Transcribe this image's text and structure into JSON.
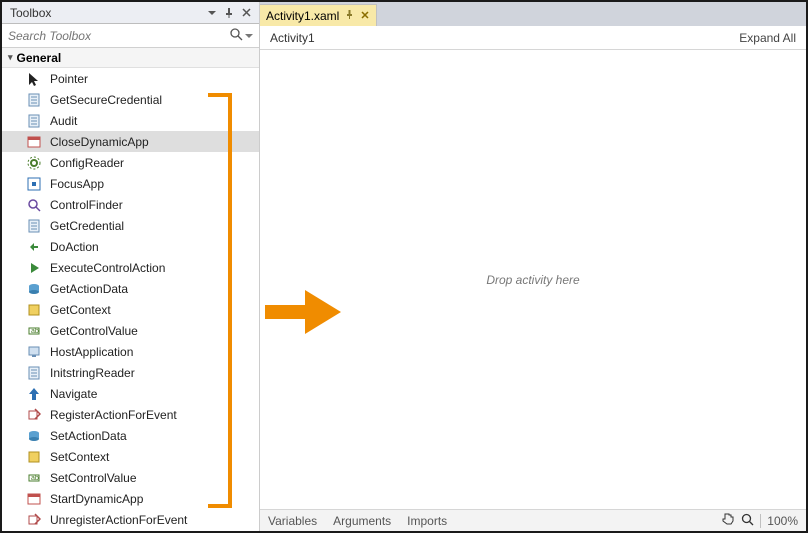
{
  "toolbox": {
    "title": "Toolbox",
    "search_placeholder": "Search Toolbox",
    "group_label": "General",
    "items": [
      {
        "name": "pointer",
        "label": "Pointer",
        "icon": "pointer",
        "selected": false
      },
      {
        "name": "getsecure",
        "label": "GetSecureCredential",
        "icon": "doc",
        "selected": false
      },
      {
        "name": "audit",
        "label": "Audit",
        "icon": "doc",
        "selected": false
      },
      {
        "name": "closedyn",
        "label": "CloseDynamicApp",
        "icon": "app",
        "selected": true
      },
      {
        "name": "configreader",
        "label": "ConfigReader",
        "icon": "gear",
        "selected": false
      },
      {
        "name": "focusapp",
        "label": "FocusApp",
        "icon": "focus",
        "selected": false
      },
      {
        "name": "ctrlfinder",
        "label": "ControlFinder",
        "icon": "find",
        "selected": false
      },
      {
        "name": "getcred",
        "label": "GetCredential",
        "icon": "doc",
        "selected": false
      },
      {
        "name": "doaction",
        "label": "DoAction",
        "icon": "action",
        "selected": false
      },
      {
        "name": "execctrl",
        "label": "ExecuteControlAction",
        "icon": "exec",
        "selected": false
      },
      {
        "name": "getactdata",
        "label": "GetActionData",
        "icon": "data",
        "selected": false
      },
      {
        "name": "getcontext",
        "label": "GetContext",
        "icon": "ctx",
        "selected": false
      },
      {
        "name": "getctrlval",
        "label": "GetControlValue",
        "icon": "val",
        "selected": false
      },
      {
        "name": "hostapp",
        "label": "HostApplication",
        "icon": "host",
        "selected": false
      },
      {
        "name": "initstr",
        "label": "InitstringReader",
        "icon": "doc",
        "selected": false
      },
      {
        "name": "navigate",
        "label": "Navigate",
        "icon": "nav",
        "selected": false
      },
      {
        "name": "regaction",
        "label": "RegisterActionForEvent",
        "icon": "reg",
        "selected": false
      },
      {
        "name": "setactdata",
        "label": "SetActionData",
        "icon": "data",
        "selected": false
      },
      {
        "name": "setcontext",
        "label": "SetContext",
        "icon": "ctx",
        "selected": false
      },
      {
        "name": "setctrlval",
        "label": "SetControlValue",
        "icon": "val",
        "selected": false
      },
      {
        "name": "startdyn",
        "label": "StartDynamicApp",
        "icon": "app",
        "selected": false
      },
      {
        "name": "unregaction",
        "label": "UnregisterActionForEvent",
        "icon": "reg",
        "selected": false
      }
    ]
  },
  "designer": {
    "tab_label": "Activity1.xaml",
    "breadcrumb": "Activity1",
    "expand_label": "Expand All",
    "drop_hint": "Drop activity here",
    "bottom_tabs": {
      "variables": "Variables",
      "arguments": "Arguments",
      "imports": "Imports"
    },
    "zoom": "100%"
  }
}
